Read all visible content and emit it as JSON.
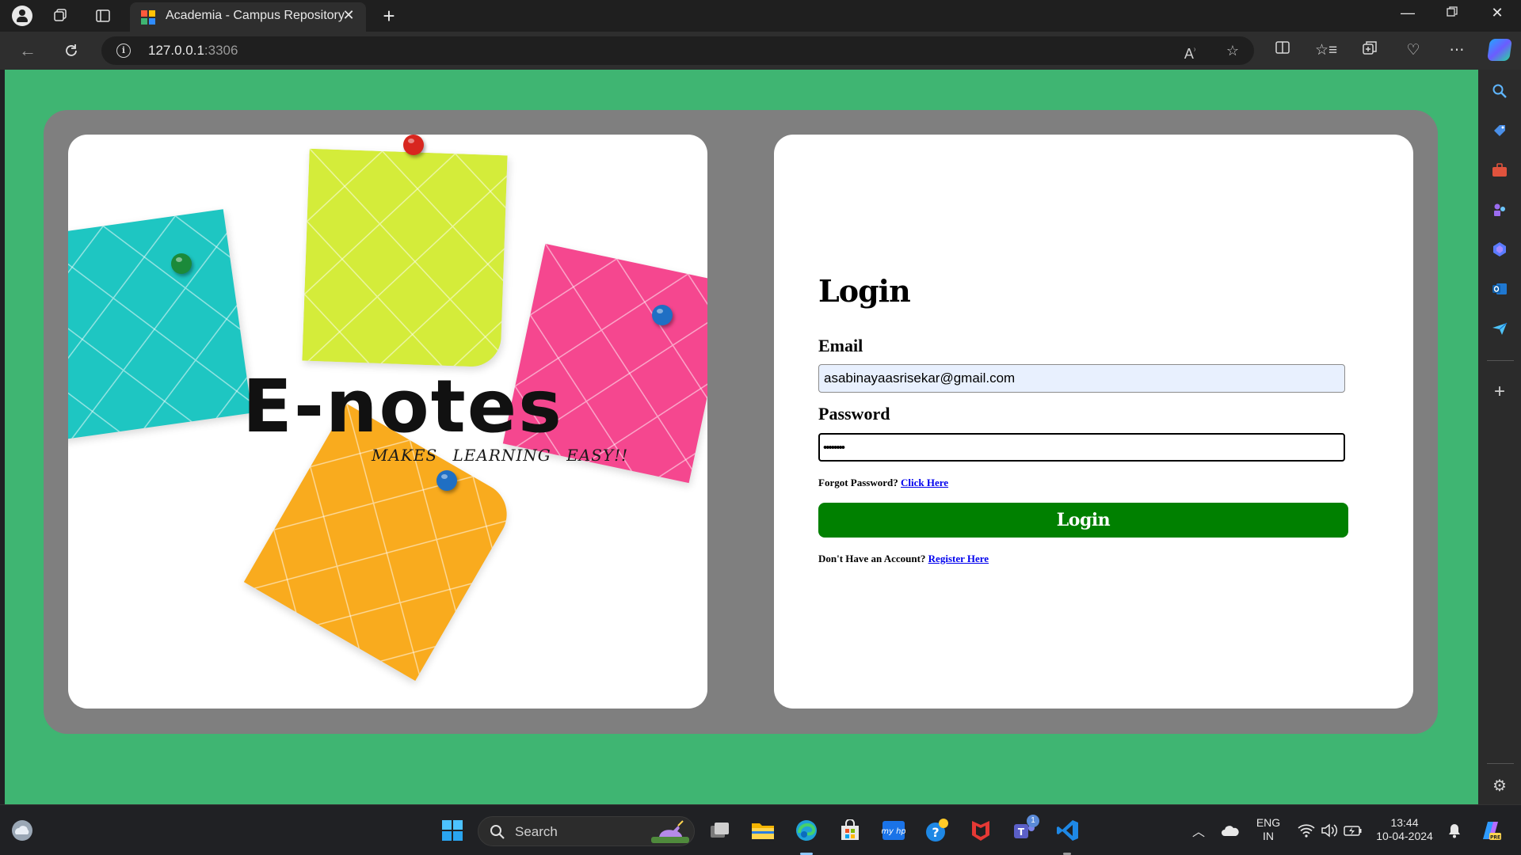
{
  "browser": {
    "tab_title": "Academia - Campus Repository",
    "url_host": "127.0.0.1",
    "url_port": ":3306"
  },
  "page": {
    "brand": "E-notes",
    "tagline": "MAKES  LEARNING  EASY!!",
    "login": {
      "title": "Login",
      "email_label": "Email",
      "email_value": "asabinayaasrisekar@gmail.com",
      "password_label": "Password",
      "password_value": "••••••••",
      "forgot_text": "Forgot Password?",
      "forgot_link": "Click Here",
      "button_label": "Login",
      "register_text": "Don't Have an Account?",
      "register_link": "Register Here"
    }
  },
  "taskbar": {
    "search_label": "Search",
    "language": "ENG",
    "region": "IN",
    "time": "13:44",
    "date": "10-04-2024",
    "teams_badge": "1"
  },
  "colors": {
    "page_bg": "#3fb572",
    "panel": "#7f7f7f",
    "login_button": "#008000",
    "note_teal": "#1ec6c2",
    "note_lime": "#d4ec3a",
    "note_pink": "#f5478f",
    "note_orange": "#f9ab1e"
  }
}
